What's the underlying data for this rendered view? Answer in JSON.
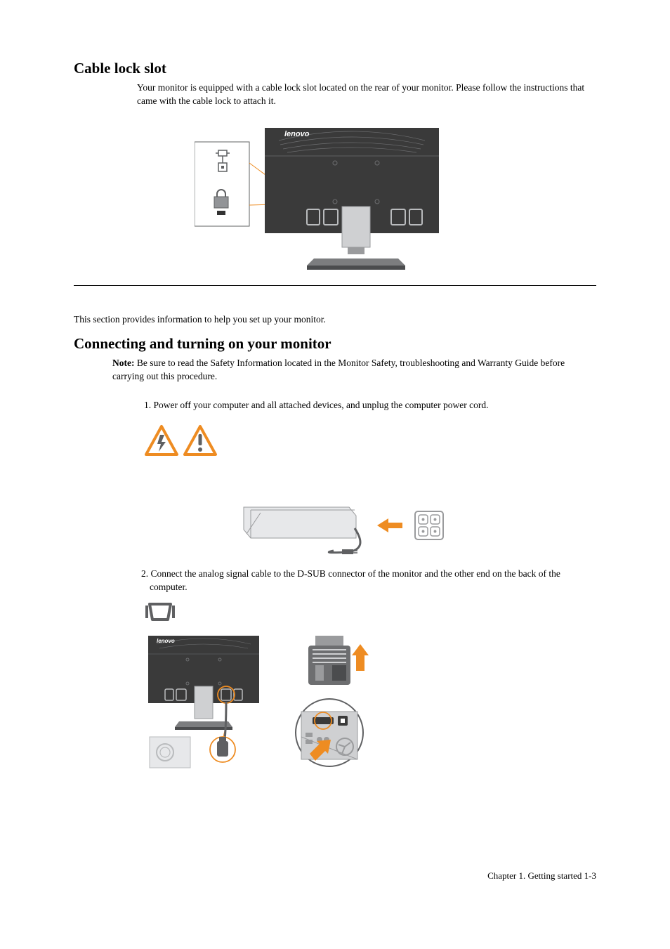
{
  "section1": {
    "heading": "Cable lock slot",
    "para": "Your monitor is equipped with a cable lock slot located on the rear of your monitor. Please follow the instructions that came with the cable lock to attach it."
  },
  "intro": "This section provides information to help you set up your monitor.",
  "section2": {
    "heading": "Connecting and turning on your monitor",
    "note_label": "Note:",
    "note_text": " Be sure to read the Safety Information located in the Monitor Safety, troubleshooting and Warranty Guide before carrying out this procedure.",
    "step1": "1. Power off your computer and all attached devices, and unplug the computer power cord.",
    "step2": "2. Connect the analog signal cable to the D-SUB connector of the monitor and the other end on the back of the computer."
  },
  "footer": "Chapter 1. Getting started 1-3",
  "icons": {
    "lock_slot": "lock-slot-icon",
    "padlock": "padlock-icon",
    "warn_electric": "electrical-warning-icon",
    "warn_general": "general-warning-icon",
    "vga": "vga-port-icon"
  },
  "brand": "lenovo"
}
